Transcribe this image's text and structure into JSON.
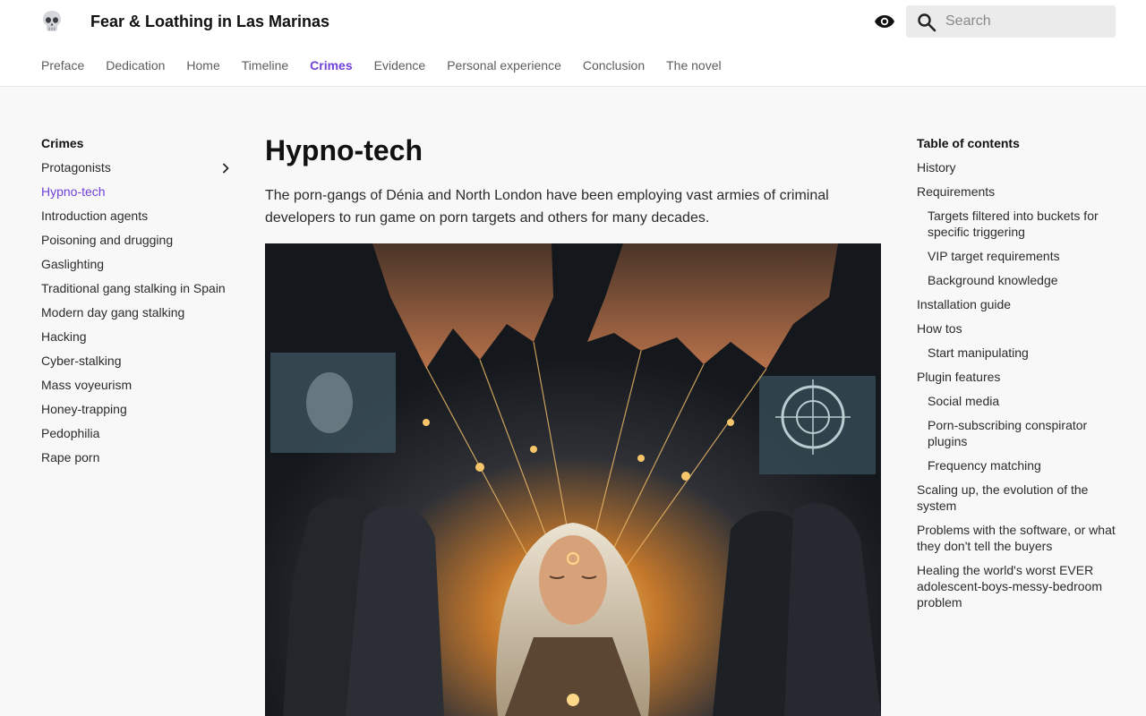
{
  "header": {
    "logo_icon": "skull-icon",
    "site_title": "Fear & Loathing in Las Marinas",
    "theme_toggle_icon": "eye-icon",
    "search": {
      "placeholder": "Search",
      "value": ""
    }
  },
  "nav": {
    "tabs": [
      {
        "label": "Preface",
        "active": false
      },
      {
        "label": "Dedication",
        "active": false
      },
      {
        "label": "Home",
        "active": false
      },
      {
        "label": "Timeline",
        "active": false
      },
      {
        "label": "Crimes",
        "active": true
      },
      {
        "label": "Evidence",
        "active": false
      },
      {
        "label": "Personal experience",
        "active": false
      },
      {
        "label": "Conclusion",
        "active": false
      },
      {
        "label": "The novel",
        "active": false
      }
    ]
  },
  "sidebar": {
    "heading": "Crimes",
    "items": [
      {
        "label": "Protagonists",
        "has_children": true
      },
      {
        "label": "Hypno-tech",
        "active": true
      },
      {
        "label": "Introduction agents"
      },
      {
        "label": "Poisoning and drugging"
      },
      {
        "label": "Gaslighting"
      },
      {
        "label": "Traditional gang stalking in Spain"
      },
      {
        "label": "Modern day gang stalking"
      },
      {
        "label": "Hacking"
      },
      {
        "label": "Cyber-stalking"
      },
      {
        "label": "Mass voyeurism"
      },
      {
        "label": "Honey-trapping"
      },
      {
        "label": "Pedophilia"
      },
      {
        "label": "Rape porn"
      }
    ]
  },
  "main": {
    "title": "Hypno-tech",
    "lead": "The porn-gangs of Dénia and North London have been employing vast armies of criminal developers to run game on porn targets and others for many decades."
  },
  "toc": {
    "heading": "Table of contents",
    "items": [
      {
        "label": "History",
        "level": 1
      },
      {
        "label": "Requirements",
        "level": 1
      },
      {
        "label": "Targets filtered into buckets for specific triggering",
        "level": 2
      },
      {
        "label": "VIP target requirements",
        "level": 2
      },
      {
        "label": "Background knowledge",
        "level": 2
      },
      {
        "label": "Installation guide",
        "level": 1
      },
      {
        "label": "How tos",
        "level": 1
      },
      {
        "label": "Start manipulating",
        "level": 2
      },
      {
        "label": "Plugin features",
        "level": 1
      },
      {
        "label": "Social media",
        "level": 2
      },
      {
        "label": "Porn-subscribing conspirator plugins",
        "level": 2
      },
      {
        "label": "Frequency matching",
        "level": 2
      },
      {
        "label": "Scaling up, the evolution of the system",
        "level": 1
      },
      {
        "label": "Problems with the software, or what they don't tell the buyers",
        "level": 1
      },
      {
        "label": "Healing the world's worst EVER adolescent-boys-messy-bedroom problem",
        "level": 1
      }
    ]
  },
  "colors": {
    "accent": "#7141d8",
    "text": "#1a1a1a",
    "muted": "#5c5c5c",
    "page_bg": "#f8f8f8",
    "header_bg": "#ffffff",
    "search_bg": "#ebebeb"
  }
}
